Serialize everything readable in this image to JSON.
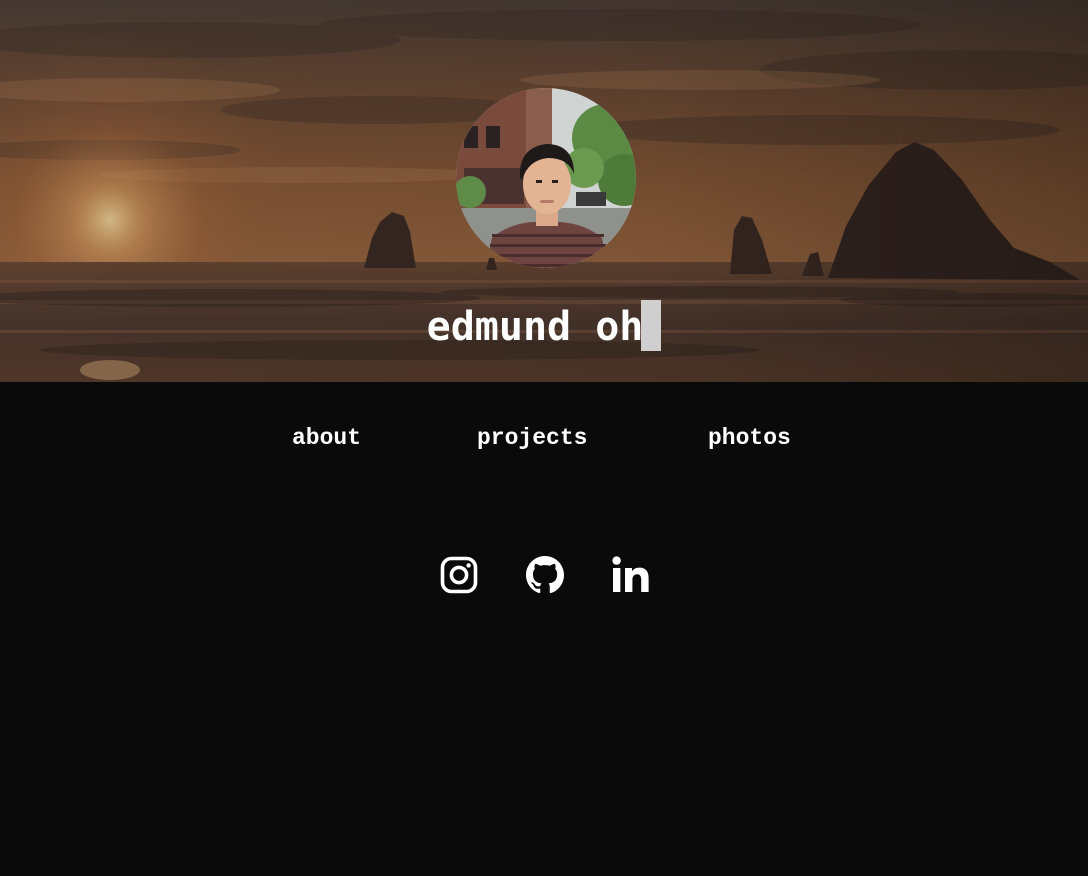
{
  "hero": {
    "name": "edmund oh",
    "background": "sunset-beach-sea-stacks",
    "avatar": "profile-photo"
  },
  "nav": {
    "about": "about",
    "projects": "projects",
    "photos": "photos"
  },
  "social": {
    "icons": [
      "instagram-icon",
      "github-icon",
      "linkedin-icon"
    ]
  },
  "colors": {
    "page_background": "#0a0a0a",
    "text": "#ffffff",
    "cursor": "#cfcfcf"
  }
}
